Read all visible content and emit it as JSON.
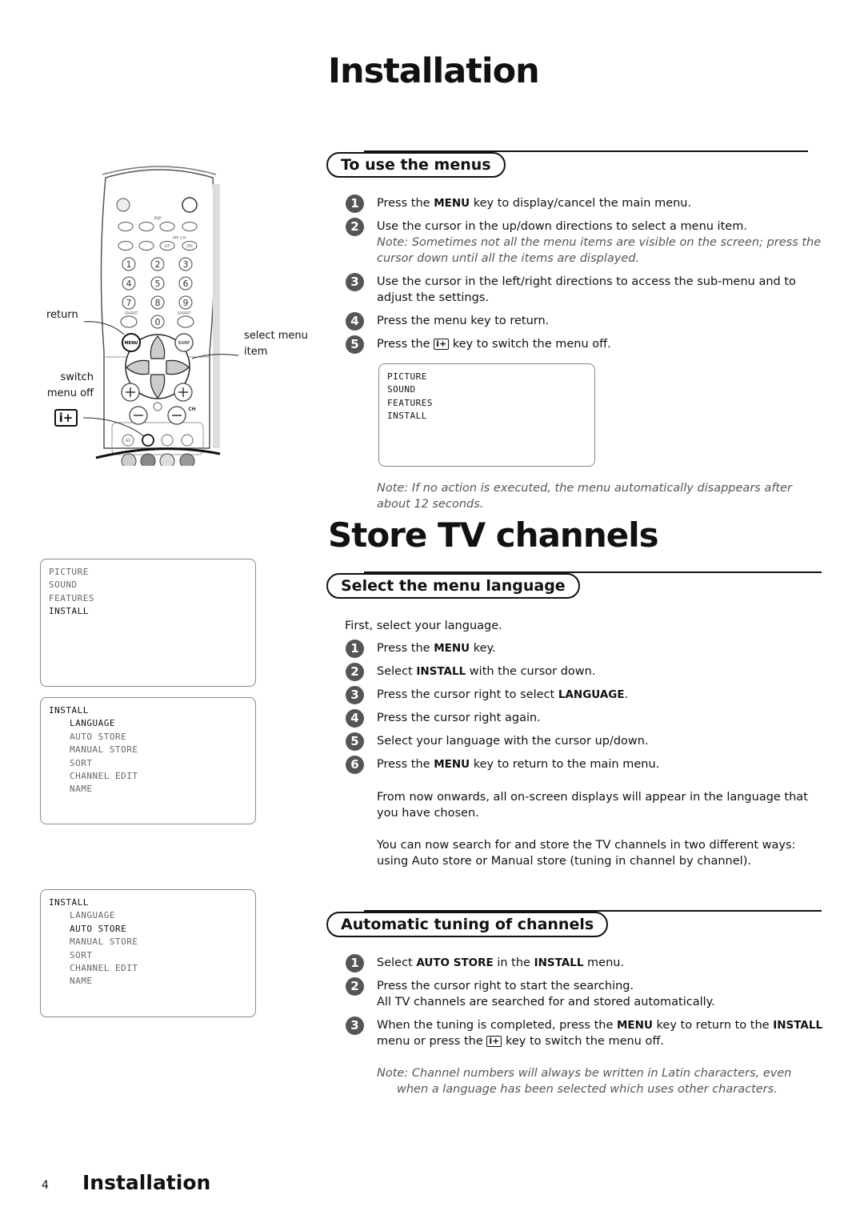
{
  "page": {
    "title": "Installation",
    "number": "4",
    "footer_title": "Installation"
  },
  "remote": {
    "labels": {
      "return": "return",
      "select_menu_item_1": "select menu",
      "select_menu_item_2": "item",
      "switch_menu_off_1": "switch",
      "switch_menu_off_2": "menu off",
      "i_plus": "i+"
    },
    "keys": {
      "pip": "PIP",
      "pipch": "PIP CH",
      "smart": "SMART",
      "menu": "MENU",
      "surf": "SURF",
      "ch": "CH",
      "av": "AV",
      "up": "UP",
      "dn": "DN",
      "digits": [
        "1",
        "2",
        "3",
        "4",
        "5",
        "6",
        "7",
        "8",
        "9",
        "0"
      ]
    }
  },
  "menus_section": {
    "heading": "To use the menus",
    "steps": [
      {
        "n": "1",
        "parts": [
          {
            "t": "Press the "
          },
          {
            "t": "MENU",
            "b": true
          },
          {
            "t": " key to display/cancel the main menu."
          }
        ]
      },
      {
        "n": "2",
        "parts": [
          {
            "t": "Use the cursor in the up/down directions to select a menu item."
          }
        ],
        "note": "Note: Sometimes not all the menu items are visible on the screen; press the cursor down until all the items are displayed."
      },
      {
        "n": "3",
        "parts": [
          {
            "t": "Use the cursor in the left/right directions to access the sub-menu and to adjust the settings."
          }
        ]
      },
      {
        "n": "4",
        "parts": [
          {
            "t": "Press the menu key to return."
          }
        ]
      },
      {
        "n": "5",
        "parts": [
          {
            "t": "Press the "
          },
          {
            "key": "i+"
          },
          {
            "t": " key to switch the menu off."
          }
        ]
      }
    ],
    "screen": {
      "items": [
        {
          "t": "PICTURE",
          "on": true
        },
        {
          "t": "SOUND",
          "on": true
        },
        {
          "t": "FEATURES",
          "on": true
        },
        {
          "t": "INSTALL",
          "on": true
        }
      ]
    },
    "note": "Note: If no action is executed, the menu automatically disappears after about 12 seconds."
  },
  "store_title": "Store TV channels",
  "language_section": {
    "heading": "Select the menu language",
    "intro": "First, select your language.",
    "steps": [
      {
        "n": "1",
        "parts": [
          {
            "t": "Press the "
          },
          {
            "t": "MENU",
            "b": true
          },
          {
            "t": " key."
          }
        ]
      },
      {
        "n": "2",
        "parts": [
          {
            "t": "Select "
          },
          {
            "t": "INSTALL",
            "b": true
          },
          {
            "t": " with the cursor down."
          }
        ]
      },
      {
        "n": "3",
        "parts": [
          {
            "t": "Press the cursor right to select "
          },
          {
            "t": "LANGUAGE",
            "b": true
          },
          {
            "t": "."
          }
        ]
      },
      {
        "n": "4",
        "parts": [
          {
            "t": "Press the cursor right again."
          }
        ]
      },
      {
        "n": "5",
        "parts": [
          {
            "t": "Select your language with the cursor up/down."
          }
        ]
      },
      {
        "n": "6",
        "parts": [
          {
            "t": "Press the "
          },
          {
            "t": "MENU",
            "b": true
          },
          {
            "t": " key to return to the main menu."
          }
        ]
      }
    ],
    "para1": "From now onwards, all on-screen displays will appear in the language that you have chosen.",
    "para2": "You can now search for and store the TV channels in two different ways: using Auto store or Manual store (tuning in channel by channel)."
  },
  "auto_section": {
    "heading": "Automatic tuning of channels",
    "steps": [
      {
        "n": "1",
        "parts": [
          {
            "t": "Select "
          },
          {
            "t": "AUTO STORE",
            "b": true
          },
          {
            "t": " in the "
          },
          {
            "t": "INSTALL",
            "b": true
          },
          {
            "t": " menu."
          }
        ]
      },
      {
        "n": "2",
        "parts": [
          {
            "t": "Press the cursor right to start the searching."
          }
        ],
        "sub": "All TV channels are searched for and stored automatically."
      },
      {
        "n": "3",
        "parts": [
          {
            "t": "When the tuning is completed, press the "
          },
          {
            "t": "MENU",
            "b": true
          },
          {
            "t": " key to return to the "
          },
          {
            "t": "INSTALL",
            "b": true
          },
          {
            "t": " menu or press the "
          },
          {
            "key": "i+"
          },
          {
            "t": " key to switch the menu off."
          }
        ]
      }
    ],
    "note": "Note: Channel numbers will always be written in Latin characters, even when a language has been selected which uses other characters."
  },
  "left_screens": [
    {
      "items": [
        {
          "t": "PICTURE"
        },
        {
          "t": "SOUND"
        },
        {
          "t": "FEATURES"
        },
        {
          "t": "INSTALL",
          "on": true
        }
      ]
    },
    {
      "items": [
        {
          "t": "INSTALL",
          "on": true
        },
        {
          "t": "LANGUAGE",
          "on": true,
          "sub": true
        },
        {
          "t": "AUTO STORE",
          "sub": true
        },
        {
          "t": "MANUAL STORE",
          "sub": true
        },
        {
          "t": "SORT",
          "sub": true
        },
        {
          "t": "CHANNEL EDIT",
          "sub": true
        },
        {
          "t": "NAME",
          "sub": true
        }
      ]
    },
    {
      "items": [
        {
          "t": "INSTALL",
          "on": true
        },
        {
          "t": "LANGUAGE",
          "sub": true
        },
        {
          "t": "AUTO STORE",
          "on": true,
          "sub": true
        },
        {
          "t": "MANUAL STORE",
          "sub": true
        },
        {
          "t": "SORT",
          "sub": true
        },
        {
          "t": "CHANNEL EDIT",
          "sub": true
        },
        {
          "t": "NAME",
          "sub": true
        }
      ]
    }
  ]
}
